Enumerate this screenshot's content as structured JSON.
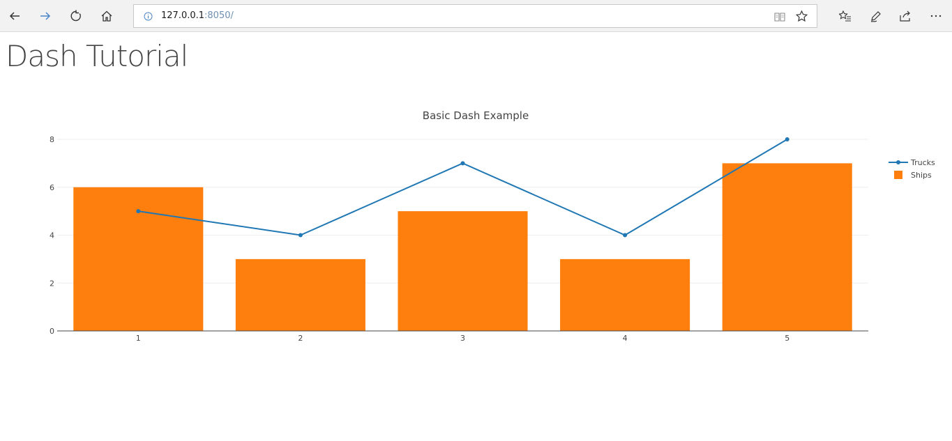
{
  "browser": {
    "url_host": "127.0.0.1",
    "url_port": ":8050/"
  },
  "icons": {
    "back": "arrow-left-icon",
    "forward": "arrow-right-icon",
    "refresh": "refresh-icon",
    "home": "home-icon",
    "info": "info-icon",
    "reading_view": "book-icon",
    "favorite": "star-icon",
    "favorites_list": "favorites-list-icon",
    "notes": "pen-icon",
    "share": "share-icon",
    "more": "ellipsis-icon"
  },
  "page": {
    "title": "Dash Tutorial"
  },
  "chart_data": {
    "type": "bar",
    "title": "Basic Dash Example",
    "xlabel": "",
    "ylabel": "",
    "categories": [
      1,
      2,
      3,
      4,
      5
    ],
    "ylim": [
      0,
      8
    ],
    "yticks": [
      0,
      2,
      4,
      6,
      8
    ],
    "grid": true,
    "legend": "top-right",
    "series": [
      {
        "name": "Trucks",
        "type": "line",
        "color": "#1f77b4",
        "values": [
          5,
          4,
          7,
          4,
          8
        ]
      },
      {
        "name": "Ships",
        "type": "bar",
        "color": "#ff7f0e",
        "values": [
          6,
          3,
          5,
          3,
          7
        ]
      }
    ]
  }
}
